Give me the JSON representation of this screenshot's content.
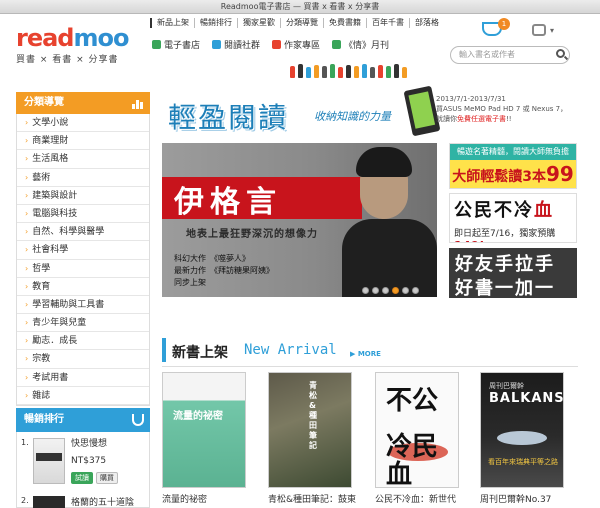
{
  "window": {
    "title": "Readmoo電子書店 — 買書 x 看書 x 分享書"
  },
  "logo": {
    "word_a": "read",
    "word_b": "moo",
    "tagline": "買書 × 看書 × 分享書"
  },
  "topnav": [
    "新品上架",
    "暢銷排行",
    "獨家星歡",
    "分類導覽",
    "免費書籍",
    "百年千書",
    "部落格"
  ],
  "channels": [
    {
      "label": "電子書店",
      "color": "#3aa55a"
    },
    {
      "label": "閱讀社群",
      "color": "#2f9fd8"
    },
    {
      "label": "作家專區",
      "color": "#e7422e"
    },
    {
      "label": "《情》月刊",
      "color": "#3aa55a"
    }
  ],
  "cart": {
    "count": "1"
  },
  "search": {
    "placeholder": "輸入書名或作者"
  },
  "sidebar": {
    "heading": "分類導覽",
    "categories": [
      "文學小說",
      "商業理財",
      "生活風格",
      "藝術",
      "建築與設計",
      "電腦與科技",
      "自然、科學與醫學",
      "社會科學",
      "哲學",
      "教育",
      "學習輔助與工具書",
      "青少年與兒童",
      "勵志．成長",
      "宗教",
      "考試用書",
      "雜誌"
    ]
  },
  "ranking": {
    "heading": "暢銷排行",
    "items": [
      {
        "num": "1.",
        "title": "快思慢想",
        "price": "NT$375",
        "try_label": "試讀",
        "buy_label": "購買"
      },
      {
        "num": "2.",
        "title": "格蘭的五十道陰"
      }
    ]
  },
  "banner": {
    "slogan": "輕盈閱讀",
    "slogan_sub": "收納知識的力量",
    "promo_date": "2013/7/1-2013/7/31",
    "promo_line1": "買ASUS MeMO Pad HD 7 或 Nexus 7，",
    "promo_line2_a": "就讀你",
    "promo_line2_b": "免費任選電子書",
    "promo_line2_c": "!!"
  },
  "hero": {
    "name": "伊格言",
    "tagline": "地表上最狂野深沉的想像力",
    "info_1": "科幻大作　《噬夢人》",
    "info_2": "最新力作　《拜訪糖果阿姨》",
    "info_3": "同步上架"
  },
  "ads": {
    "ad1_top": "暢遊名著精髓，閱讀大師無負擔",
    "ad1_main": "大師輕鬆讀3本",
    "ad1_price": "99元",
    "ad2_title_a": "公民",
    "ad2_title_b": "不冷",
    "ad2_title_c": "血",
    "ad2_sub_a": "即日起至7/16，獨家預購",
    "ad2_sub_b": "149",
    "ad2_sub_c": "!",
    "ad3_line1": "好友手拉手",
    "ad3_line2": "好書一加一"
  },
  "new_arrival": {
    "title": "新書上架",
    "title_en": "New Arrival",
    "more": "▶ MORE",
    "books": [
      {
        "title": "流量的祕密",
        "cover_text": "流量的祕密"
      },
      {
        "title": "青松&種田筆記：鼓東",
        "cover_text": "青松&種田筆記"
      },
      {
        "title": "公民不冷血：新世代",
        "cover_text_a": "不公",
        "cover_text_b": "冷民血"
      },
      {
        "title": "周刊巴爾幹No.37",
        "cover_head": "周刊巴爾幹",
        "cover_text": "BALKANS",
        "cover_sub": "看百年來瑞典平等之路"
      }
    ]
  }
}
